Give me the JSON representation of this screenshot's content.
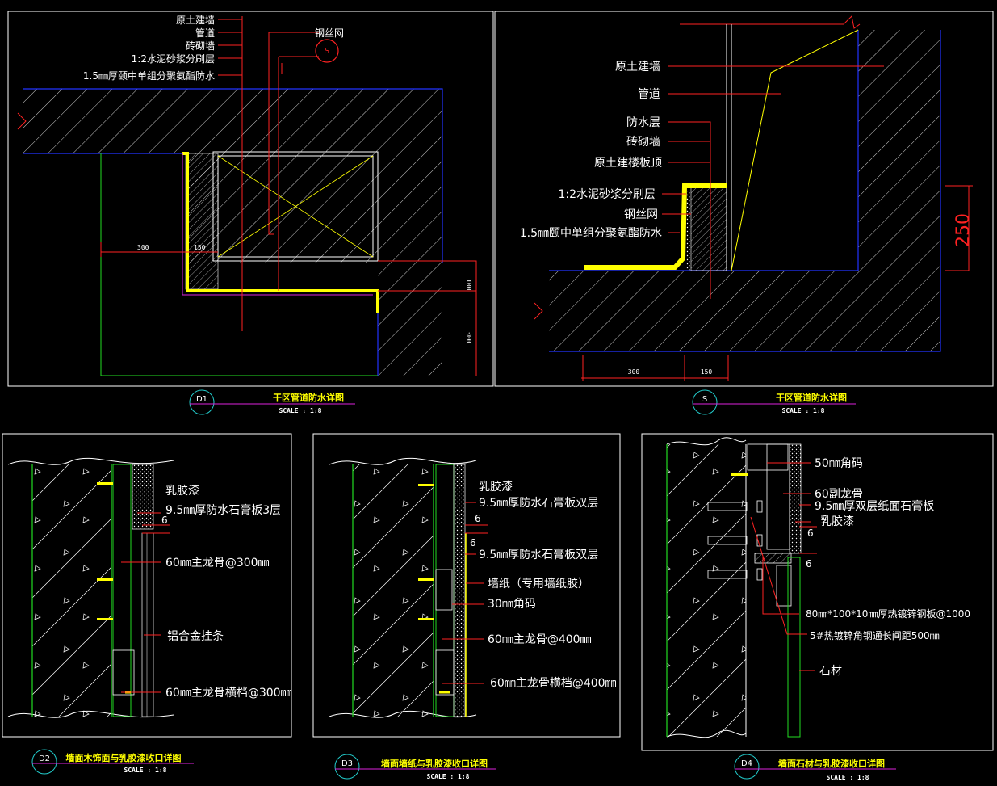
{
  "colors": {
    "background": "#000000",
    "frame": "#ffffff",
    "leader": "#ff2222",
    "wall": "#ffffff",
    "highlight": "#ffff00",
    "green": "#22dd22",
    "blue": "#2233ff",
    "cyan": "#22cccc",
    "magenta": "#dd22dd"
  },
  "d1": {
    "tag": "D1",
    "title": "干区管道防水详图",
    "scale": "SCALE : 1:8",
    "labels": [
      "原土建墙",
      "管道",
      "砖砌墙",
      "1:2水泥砂浆分刷层",
      "1.5㎜厚颐中单组分聚氨酯防水"
    ],
    "mesh_label": "钢丝网",
    "marker": "S",
    "dims": {
      "d300": "300",
      "d150": "150",
      "d100": "100",
      "d300v": "300"
    }
  },
  "s": {
    "tag": "S",
    "title": "干区管道防水详图",
    "scale": "SCALE : 1:8",
    "labels": [
      "原土建墙",
      "管道",
      "防水层",
      "砖砌墙",
      "原土建楼板顶",
      "1:2水泥砂浆分刷层",
      "钢丝网",
      "1.5㎜颐中单组分聚氨酯防水"
    ],
    "dims": {
      "d300": "300",
      "d150": "150",
      "d250": "250"
    }
  },
  "d2": {
    "tag": "D2",
    "title": "墙面木饰面与乳胶漆收口详图",
    "scale": "SCALE : 1:8",
    "labels": [
      "乳胶漆",
      "9.5㎜厚防水石膏板3层",
      "60㎜主龙骨@300㎜",
      "铝合金挂条",
      "60㎜主龙骨横档@300㎜"
    ],
    "dim6": "6"
  },
  "d3": {
    "tag": "D3",
    "title": "墙面墙纸与乳胶漆收口详图",
    "scale": "SCALE : 1:8",
    "labels": [
      "乳胶漆",
      "9.5㎜厚防水石膏板双层",
      "9.5㎜厚防水石膏板双层",
      "墙纸（专用墙纸胶）",
      "30㎜角码",
      "60㎜主龙骨@400㎜",
      "60㎜主龙骨横档@400㎜"
    ],
    "dim6a": "6",
    "dim6b": "6"
  },
  "d4": {
    "tag": "D4",
    "title": "墙面石材与乳胶漆收口详图",
    "scale": "SCALE : 1:8",
    "labels": [
      "50㎜角码",
      "60副龙骨",
      "9.5㎜厚双层纸面石膏板",
      "乳胶漆",
      "80㎜*100*10㎜厚热镀锌钢板@1000",
      "5#热镀锌角钢通长间距500㎜",
      "石材"
    ],
    "dim6a": "6",
    "dim6b": "6"
  }
}
